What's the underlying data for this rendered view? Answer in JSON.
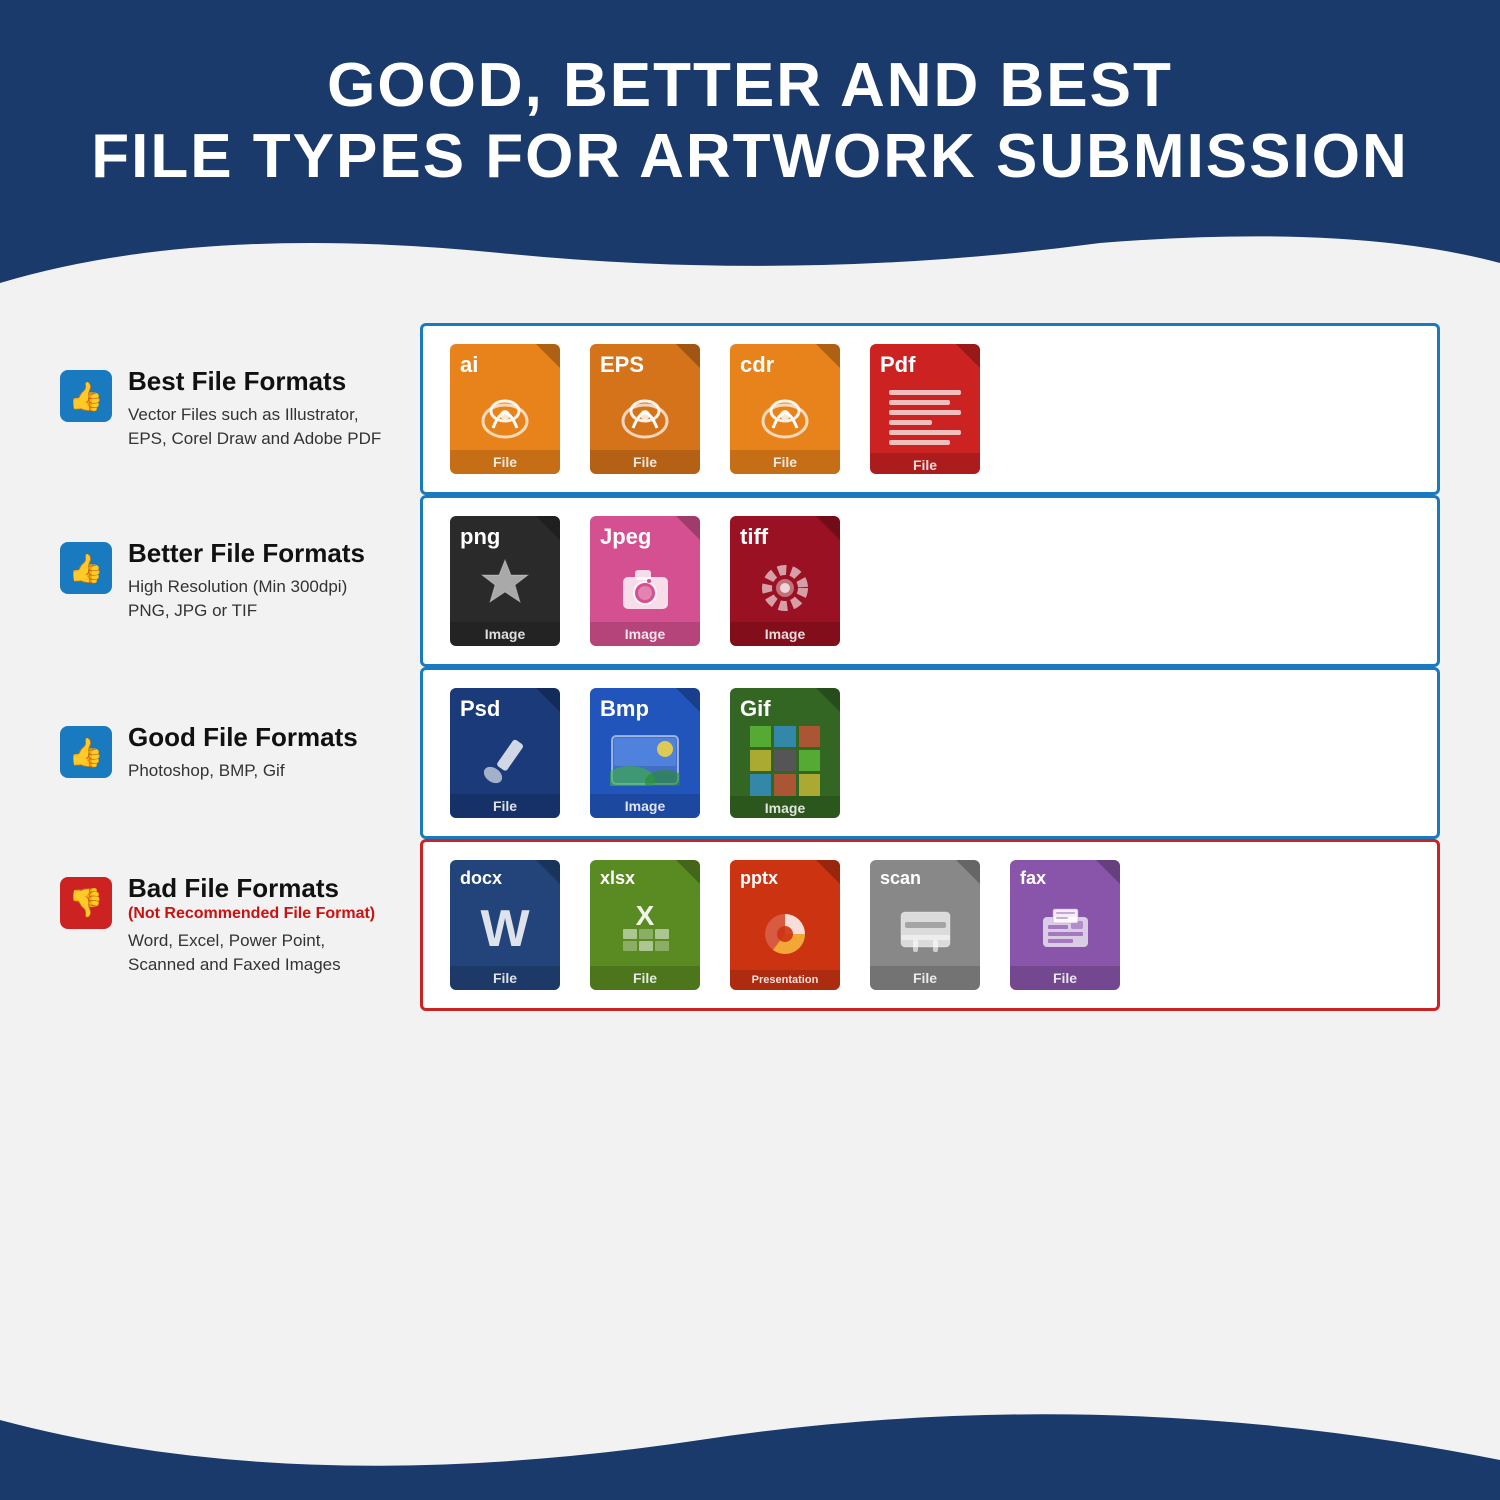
{
  "header": {
    "line1": "GOOD, BETTER AND BEST",
    "line2": "FILE TYPES FOR ARTWORK SUBMISSION"
  },
  "rows": [
    {
      "id": "best",
      "category": "Best File Formats",
      "subtitle": null,
      "description": "Vector Files such as Illustrator,\nEPS, Corel Draw and Adobe PDF",
      "thumb": "up",
      "borderColor": "blue",
      "files": [
        {
          "ext": "ai",
          "color": "orange",
          "label": "File",
          "icon": "vector"
        },
        {
          "ext": "EPS",
          "color": "orange2",
          "label": "File",
          "icon": "vector"
        },
        {
          "ext": "cdr",
          "color": "orange",
          "label": "File",
          "icon": "vector"
        },
        {
          "ext": "Pdf",
          "color": "red",
          "label": "File",
          "icon": "doclines"
        }
      ]
    },
    {
      "id": "better",
      "category": "Better File Formats",
      "subtitle": null,
      "description": "High Resolution (Min 300dpi)\nPNG, JPG or TIF",
      "thumb": "up",
      "borderColor": "blue",
      "files": [
        {
          "ext": "png",
          "color": "black",
          "label": "Image",
          "icon": "snowflake"
        },
        {
          "ext": "Jpeg",
          "color": "pink",
          "label": "Image",
          "icon": "camera"
        },
        {
          "ext": "tiff",
          "color": "darkred",
          "label": "Image",
          "icon": "gear"
        }
      ]
    },
    {
      "id": "good",
      "category": "Good File Formats",
      "subtitle": null,
      "description": "Photoshop, BMP, Gif",
      "thumb": "up",
      "borderColor": "blue",
      "files": [
        {
          "ext": "Psd",
          "color": "navy",
          "label": "File",
          "icon": "brush"
        },
        {
          "ext": "Bmp",
          "color": "blue",
          "label": "Image",
          "icon": "landscape"
        },
        {
          "ext": "Gif",
          "color": "green",
          "label": "Image",
          "icon": "gifgrid"
        }
      ]
    },
    {
      "id": "bad",
      "category": "Bad File Formats",
      "subtitle": "(Not Recommended File Format)",
      "description": "Word, Excel, Power Point,\nScanned and Faxed Images",
      "thumb": "down",
      "borderColor": "red",
      "files": [
        {
          "ext": "docx",
          "color": "navy2",
          "label": "File",
          "icon": "wordw"
        },
        {
          "ext": "xlsx",
          "color": "limegreen",
          "label": "File",
          "icon": "excelx"
        },
        {
          "ext": "pptx",
          "color": "red2",
          "label": "Presentation",
          "icon": "pptchart"
        },
        {
          "ext": "scan",
          "color": "gray",
          "label": "File",
          "icon": "scanicon"
        },
        {
          "ext": "fax",
          "color": "purple",
          "label": "File",
          "icon": "faxicon"
        }
      ]
    }
  ]
}
